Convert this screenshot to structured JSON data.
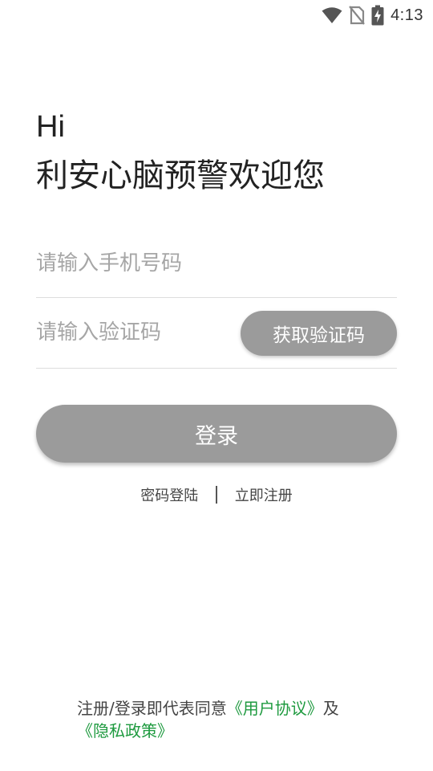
{
  "status_bar": {
    "time": "4:13",
    "icons": [
      "wifi-icon",
      "no-sim-icon",
      "battery-charging-icon"
    ]
  },
  "greeting": {
    "hi": "Hi",
    "welcome": "利安心脑预警欢迎您"
  },
  "form": {
    "phone_placeholder": "请输入手机号码",
    "phone_value": "",
    "code_placeholder": "请输入验证码",
    "code_value": "",
    "get_code_label": "获取验证码",
    "login_label": "登录"
  },
  "links": {
    "password_login": "密码登陆",
    "register_now": "立即注册"
  },
  "agreement": {
    "prefix": "注册/登录即代表同意",
    "user_agreement": "《用户协议》",
    "and": "及",
    "privacy_policy": "《隐私政策》"
  },
  "colors": {
    "button_gray": "#9b9b9b",
    "link_green": "#1e9a3f",
    "divider": "#dddddd"
  }
}
